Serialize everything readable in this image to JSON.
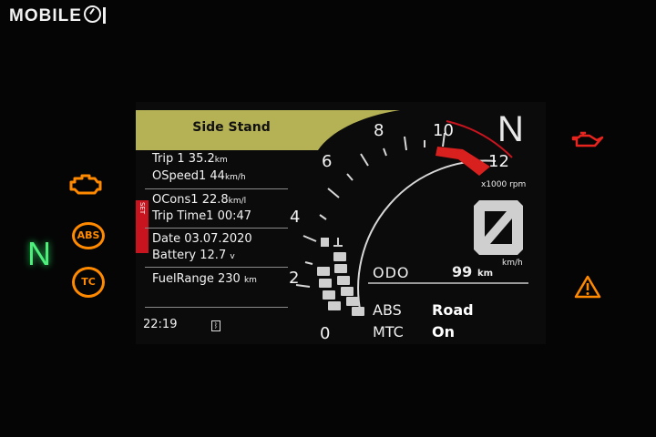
{
  "logo": {
    "text": "MOBILE"
  },
  "indicators": {
    "neutral_left": "N",
    "abs": "ABS",
    "tc": "TC",
    "engine_color": "#ff8a00",
    "oil_color": "#e8241e",
    "hazard_color": "#ff8a00",
    "neutral_color": "#4cf07a"
  },
  "banner": {
    "text": "Side Stand",
    "color": "#b5b255"
  },
  "trip": {
    "trip1_label": "Trip 1",
    "trip1_value": "35.2",
    "trip1_unit": "km",
    "ospeed_label": "OSpeed1",
    "ospeed_value": "44",
    "ospeed_unit": "km/h"
  },
  "cons": {
    "cons_label": "OCons1",
    "cons_value": "22.8",
    "cons_unit": "km/l",
    "time_label": "Trip Time1",
    "time_value": "00:47",
    "set_tab": "SET"
  },
  "info": {
    "date_label": "Date",
    "date_value": "03.07.2020",
    "battery_label": "Battery",
    "battery_value": "12.7",
    "battery_unit": "v"
  },
  "fuel": {
    "label": "FuelRange",
    "value": "230",
    "unit": "km"
  },
  "status": {
    "clock": "22:19",
    "bt_icon": "bluetooth-icon"
  },
  "tacho": {
    "scale": [
      "0",
      "2",
      "4",
      "6",
      "8",
      "10",
      "12"
    ],
    "unit": "x1000 rpm",
    "redline_color": "#d8201e"
  },
  "gear": {
    "display": "N"
  },
  "speed": {
    "value": "0",
    "unit": "km/h"
  },
  "odo": {
    "label": "ODO",
    "value": "99",
    "unit": "km"
  },
  "modes": {
    "abs_label": "ABS",
    "abs_value": "Road",
    "mtc_label": "MTC",
    "mtc_value": "On"
  }
}
